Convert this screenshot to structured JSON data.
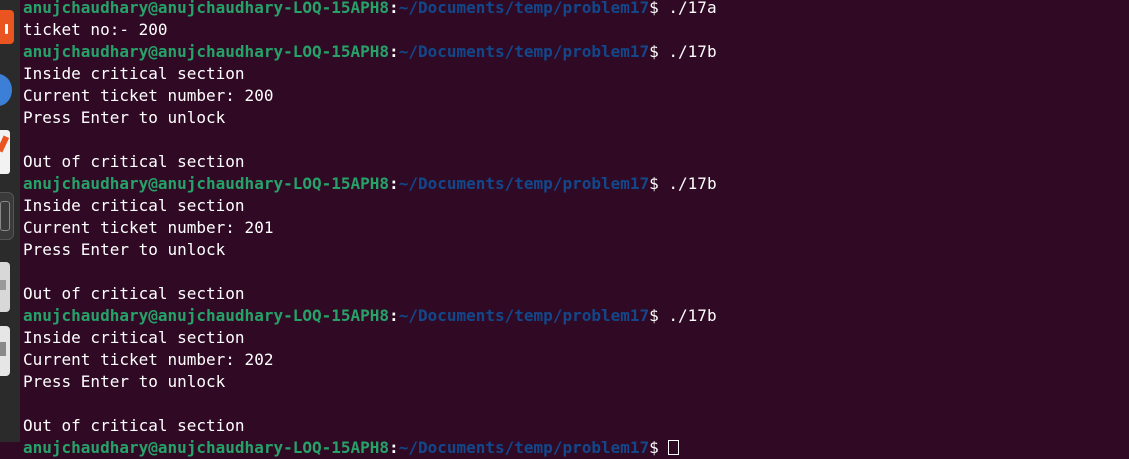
{
  "dock": {
    "icons": [
      "app-center-icon",
      "browser-icon",
      "text-editor-icon",
      "terminal-icon",
      "drive-icon",
      "disk-icon"
    ]
  },
  "terminal": {
    "prompt_user_host": "anujchaudhary@anujchaudhary-LOQ-15APH8",
    "prompt_colon": ":",
    "prompt_path": "~/Documents/temp/problem17",
    "prompt_symbol": "$ ",
    "lines": [
      {
        "type": "prompt",
        "command": "./17a"
      },
      {
        "type": "output",
        "text": "ticket no:- 200"
      },
      {
        "type": "prompt",
        "command": "./17b"
      },
      {
        "type": "output",
        "text": "Inside critical section"
      },
      {
        "type": "output",
        "text": "Current ticket number: 200"
      },
      {
        "type": "output",
        "text": "Press Enter to unlock"
      },
      {
        "type": "output",
        "text": ""
      },
      {
        "type": "output",
        "text": "Out of critical section"
      },
      {
        "type": "prompt",
        "command": "./17b"
      },
      {
        "type": "output",
        "text": "Inside critical section"
      },
      {
        "type": "output",
        "text": "Current ticket number: 201"
      },
      {
        "type": "output",
        "text": "Press Enter to unlock"
      },
      {
        "type": "output",
        "text": ""
      },
      {
        "type": "output",
        "text": "Out of critical section"
      },
      {
        "type": "prompt",
        "command": "./17b"
      },
      {
        "type": "output",
        "text": "Inside critical section"
      },
      {
        "type": "output",
        "text": "Current ticket number: 202"
      },
      {
        "type": "output",
        "text": "Press Enter to unlock"
      },
      {
        "type": "output",
        "text": ""
      },
      {
        "type": "output",
        "text": "Out of critical section"
      },
      {
        "type": "prompt",
        "command": ""
      }
    ]
  },
  "colors": {
    "background": "#300a24",
    "user_host": "#26a269",
    "path": "#12488b",
    "text": "#ffffff"
  }
}
